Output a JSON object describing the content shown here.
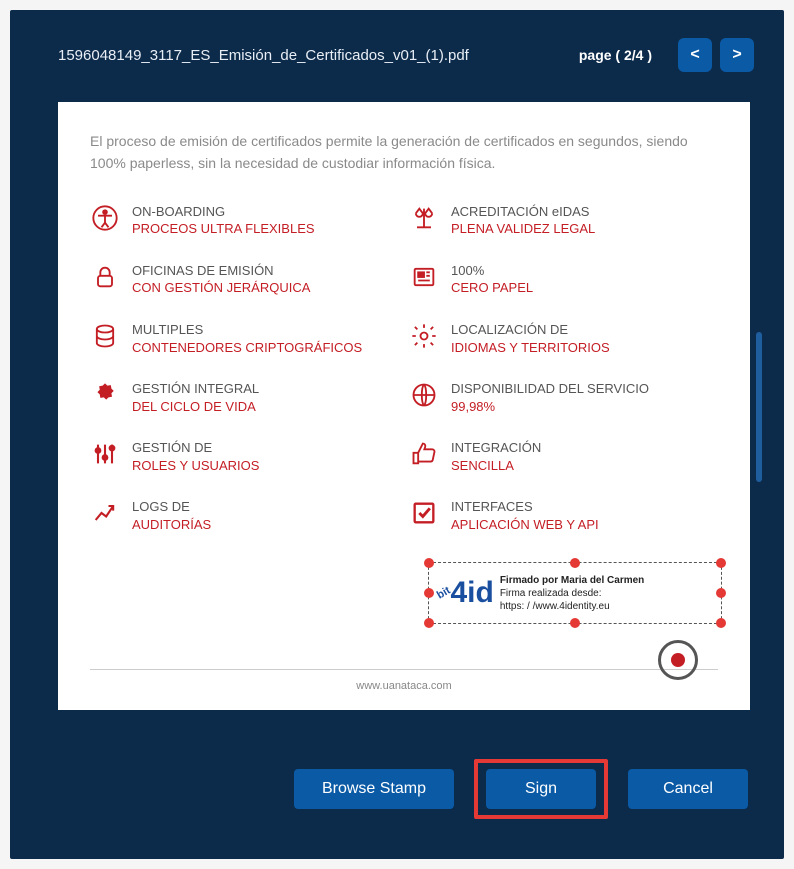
{
  "header": {
    "filename": "1596048149_3117_ES_Emisión_de_Certificados_v01_(1).pdf",
    "page_label": "page ( 2/4 )",
    "prev": "<",
    "next": ">"
  },
  "doc": {
    "intro": "El proceso de emisión de certificados permite la generación de certificados en segundos, siendo 100% paperless, sin la necesidad de custodiar información física.",
    "left": [
      {
        "icon": "accessibility",
        "title": "ON-BOARDING",
        "sub": "PROCEOS ULTRA FLEXIBLES"
      },
      {
        "icon": "lock",
        "title": "OFICINAS DE EMISIÓN",
        "sub": "CON GESTIÓN JERÁRQUICA"
      },
      {
        "icon": "database",
        "title": "MULTIPLES",
        "sub": "CONTENEDORES CRIPTOGRÁFICOS"
      },
      {
        "icon": "badge",
        "title": "GESTIÓN INTEGRAL",
        "sub": "DEL CICLO DE VIDA"
      },
      {
        "icon": "sliders",
        "title": "GESTIÓN DE",
        "sub": "ROLES Y USUARIOS"
      },
      {
        "icon": "chart",
        "title": "LOGS DE",
        "sub": "AUDITORÍAS"
      }
    ],
    "right": [
      {
        "icon": "scales",
        "title": "ACREDITACIÓN eIDAS",
        "sub": "PLENA VALIDEZ LEGAL"
      },
      {
        "icon": "newspaper",
        "title": "100%",
        "sub": "CERO PAPEL"
      },
      {
        "icon": "gear",
        "title": "LOCALIZACIÓN DE",
        "sub": "IDIOMAS Y TERRITORIOS"
      },
      {
        "icon": "globe",
        "title": "DISPONIBILIDAD DEL SERVICIO",
        "sub": "99,98%"
      },
      {
        "icon": "thumbsup",
        "title": "INTEGRACIÓN",
        "sub": "SENCILLA"
      },
      {
        "icon": "check",
        "title": "INTERFACES",
        "sub": "APLICACIÓN WEB Y API"
      }
    ],
    "footer_url": "www.uanataca.com",
    "stamp": {
      "logo_text": "4id",
      "line1": "Firmado por Maria del Carmen",
      "line2": "Firma realizada desde:",
      "line3": "https: / /www.4identity.eu"
    }
  },
  "actions": {
    "browse": "Browse Stamp",
    "sign": "Sign",
    "cancel": "Cancel"
  }
}
